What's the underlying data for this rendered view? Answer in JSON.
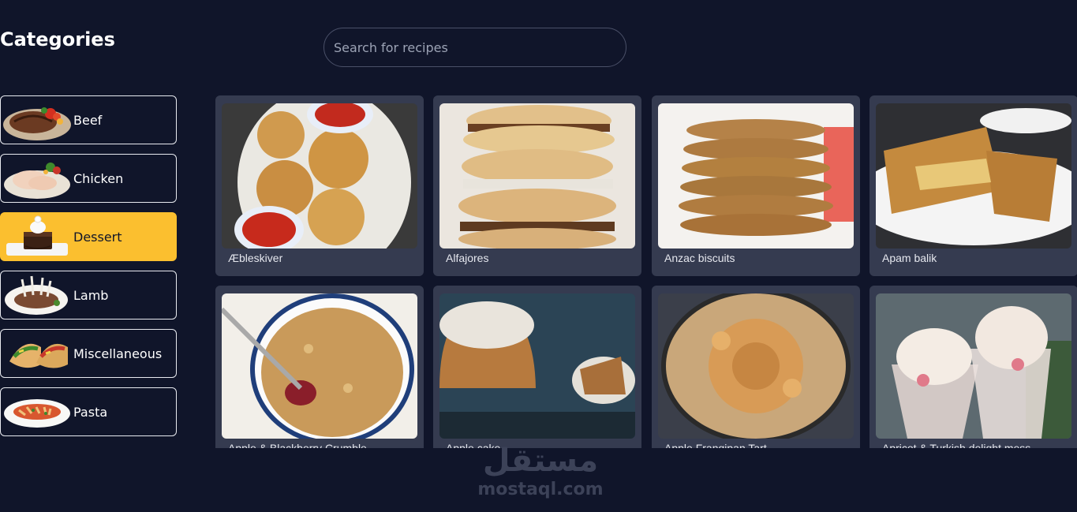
{
  "sidebar": {
    "title": "Categories",
    "items": [
      {
        "label": "Beef",
        "icon": "beef-icon",
        "active": false
      },
      {
        "label": "Chicken",
        "icon": "chicken-icon",
        "active": false
      },
      {
        "label": "Dessert",
        "icon": "dessert-icon",
        "active": true
      },
      {
        "label": "Lamb",
        "icon": "lamb-icon",
        "active": false
      },
      {
        "label": "Miscellaneous",
        "icon": "tacos-icon",
        "active": false
      },
      {
        "label": "Pasta",
        "icon": "pasta-icon",
        "active": false
      }
    ]
  },
  "search": {
    "placeholder": "Search for recipes",
    "value": ""
  },
  "recipes": [
    {
      "name": "Æbleskiver"
    },
    {
      "name": "Alfajores"
    },
    {
      "name": "Anzac biscuits"
    },
    {
      "name": "Apam balik"
    },
    {
      "name": "Apple & Blackberry Crumble"
    },
    {
      "name": "Apple cake"
    },
    {
      "name": "Apple Frangipan Tart"
    },
    {
      "name": "Apricot & Turkish delight mess"
    }
  ],
  "watermark": {
    "arabic": "مستقل",
    "domain": "mostaql.com"
  },
  "colors": {
    "background": "#10152a",
    "card": "#353b50",
    "accent": "#fbbf2f"
  }
}
